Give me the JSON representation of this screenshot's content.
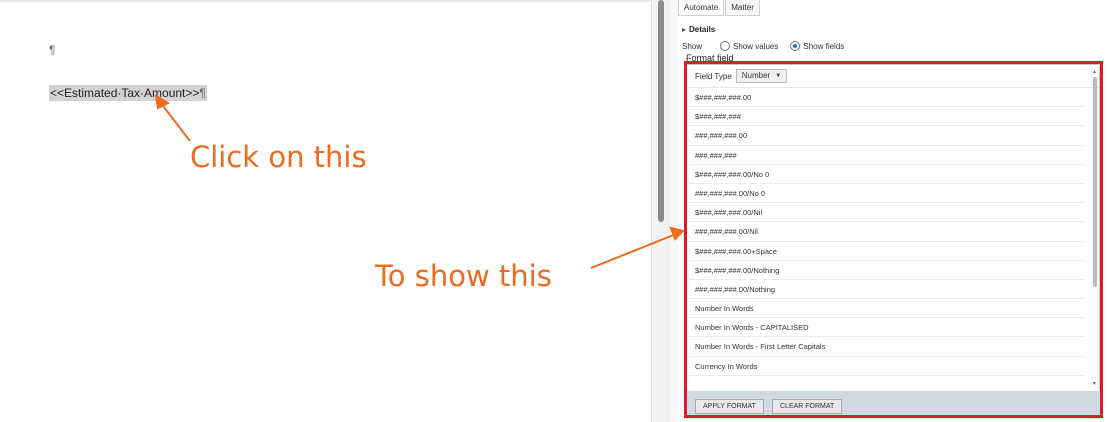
{
  "document": {
    "pilcrow": "¶",
    "merge_field": "<<Estimated·Tax·Amount>>",
    "merge_field_mark": "¶"
  },
  "panel": {
    "tabs": [
      {
        "label": "Automate",
        "active": true
      },
      {
        "label": "Matter",
        "active": false
      }
    ],
    "details_label": "Details",
    "show_label": "Show",
    "show_values_label": "Show values",
    "show_fields_label": "Show fields",
    "show_selected": "Show fields",
    "format_field_label": "Format field",
    "field_type_label": "Field Type",
    "field_type_value": "Number",
    "format_options": [
      "$###,###,###.00",
      "$###,###,###",
      "###,###,###.00",
      "###,###,###",
      "$###,###,###.00/No 0",
      "###,###,###.00/No 0",
      "$###,###,###.00/Nil",
      "###,###,###.00/Nil",
      "$###,###,###.00+Space",
      "$###,###,###.00/Nothing",
      "###,###,###.00/Nothing",
      "Number In Words",
      "Number In Words - CAPITALISED",
      "Number In Words - First Letter Capitals",
      "Currency In Words"
    ],
    "apply_format_label": "APPLY FORMAT",
    "clear_format_label": "CLEAR FORMAT"
  },
  "annotations": {
    "click_on_this": "Click on this",
    "to_show_this": "To show this",
    "color": "#ee6a1f",
    "highlight_color": "#e21b23"
  }
}
